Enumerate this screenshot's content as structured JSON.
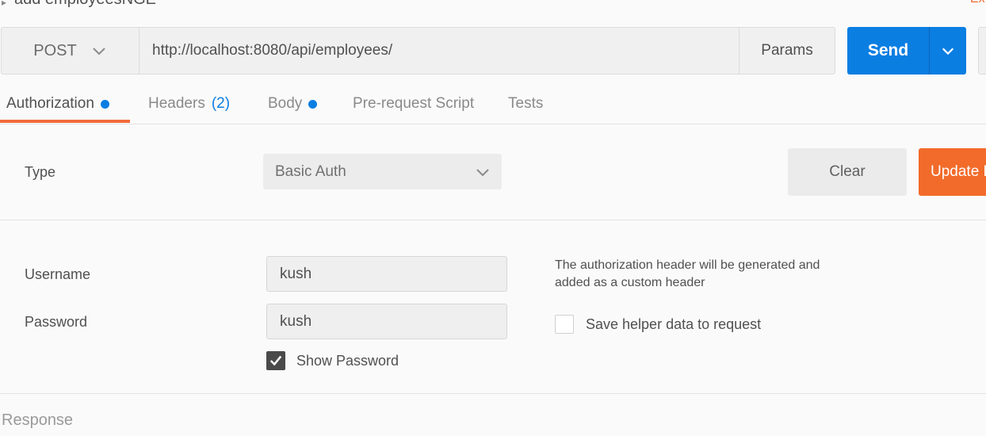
{
  "header": {
    "request_title": "add employeesNGE",
    "right_link": "Ex"
  },
  "urlbar": {
    "method": "POST",
    "url": "http://localhost:8080/api/employees/",
    "params_label": "Params",
    "send_label": "Send"
  },
  "tabs": [
    {
      "label": "Authorization",
      "active": true,
      "dot": true
    },
    {
      "label": "Headers",
      "count": "(2)"
    },
    {
      "label": "Body",
      "dot": true
    },
    {
      "label": "Pre-request Script"
    },
    {
      "label": "Tests"
    }
  ],
  "auth": {
    "type_label": "Type",
    "type_value": "Basic Auth",
    "clear_label": "Clear",
    "update_label": "Update Request",
    "username_label": "Username",
    "username_value": "kush",
    "password_label": "Password",
    "password_value": "kush",
    "show_password_label": "Show Password",
    "show_password_checked": true,
    "help_text": "The authorization header will be generated and added as a custom header",
    "save_helper_label": "Save helper data to request",
    "save_helper_checked": false
  },
  "response": {
    "label": "Response"
  },
  "colors": {
    "accent_orange": "#f26b2a",
    "accent_blue": "#0b7ee2"
  }
}
